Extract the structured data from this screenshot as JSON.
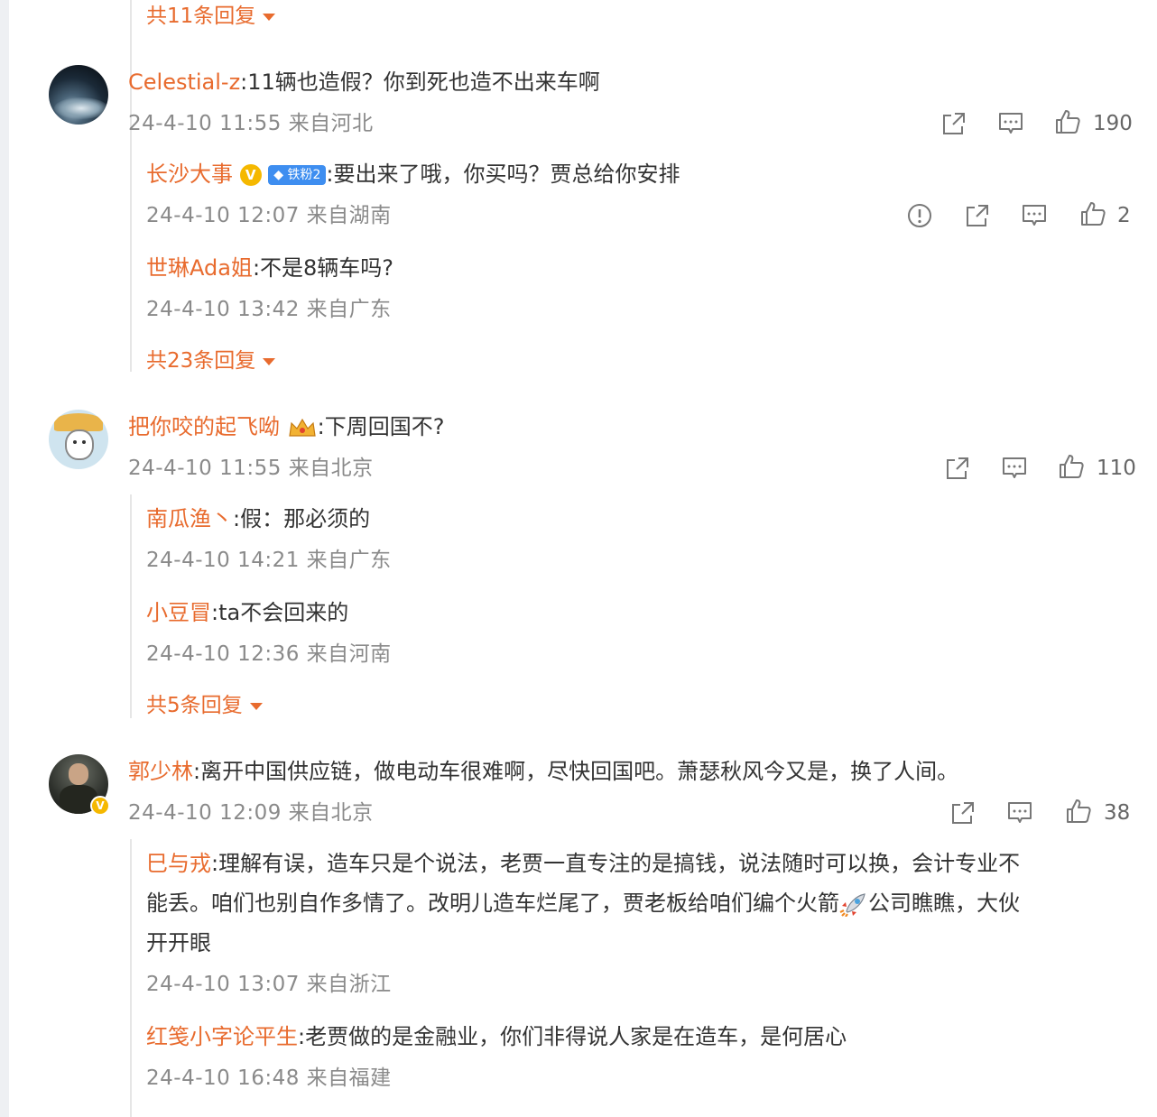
{
  "thread0": {
    "more": "共11条回复"
  },
  "c1": {
    "name": "Celestial-z",
    "text": ":11辆也造假？你到死也造不出来车啊",
    "meta": "24-4-10 11:55 来自河北",
    "likes": "190",
    "replies": [
      {
        "name": "长沙大事",
        "badge": "铁粉2",
        "text": ":要出来了哦，你买吗？贾总给你安排",
        "meta": "24-4-10 12:07 来自湖南",
        "likes": "2"
      },
      {
        "name": "世琳Ada姐",
        "text": ":不是8辆车吗?",
        "meta": "24-4-10 13:42 来自广东"
      }
    ],
    "more": "共23条回复"
  },
  "c2": {
    "name": "把你咬的起飞呦",
    "text": ":下周回国不?",
    "meta": "24-4-10 11:55 来自北京",
    "likes": "110",
    "replies": [
      {
        "name": "南瓜渔丶",
        "text": ":假：那必须的",
        "meta": "24-4-10 14:21 来自广东"
      },
      {
        "name": "小豆冒",
        "text": ":ta不会回来的",
        "meta": "24-4-10 12:36 来自河南"
      }
    ],
    "more": "共5条回复"
  },
  "c3": {
    "name": "郭少林",
    "text": ":离开中国供应链，做电动车很难啊，尽快回国吧。萧瑟秋风今又是，换了人间。",
    "meta": "24-4-10 12:09 来自北京",
    "likes": "38",
    "replies": [
      {
        "name": "巳与戎",
        "text1": ":理解有误，造车只是个说法，老贾一直专注的是搞钱，说法随时可以换，会计专业不",
        "text2": "能丢。咱们也别自作多情了。改明儿造车烂尾了，贾老板给咱们编个火箭",
        "text2b": "公司瞧瞧，大伙",
        "text3": "开开眼",
        "meta": "24-4-10 13:07 来自浙江"
      },
      {
        "name": "红笺小字论平生",
        "text": ":老贾做的是金融业，你们非得说人家是在造车，是何居心",
        "meta": "24-4-10 16:48 来自福建"
      }
    ]
  },
  "icons": {
    "share": "share-icon",
    "comment": "comment-icon",
    "like": "thumbs-up-icon",
    "report": "report-icon",
    "expand": "caret-down-icon",
    "rocket": "rocket-emoji"
  },
  "colors": {
    "name": "#e86b2e",
    "meta": "#8a8a8a",
    "text": "#333333",
    "verified": "#f5b800",
    "fan_badge": "#3e8ef0"
  }
}
